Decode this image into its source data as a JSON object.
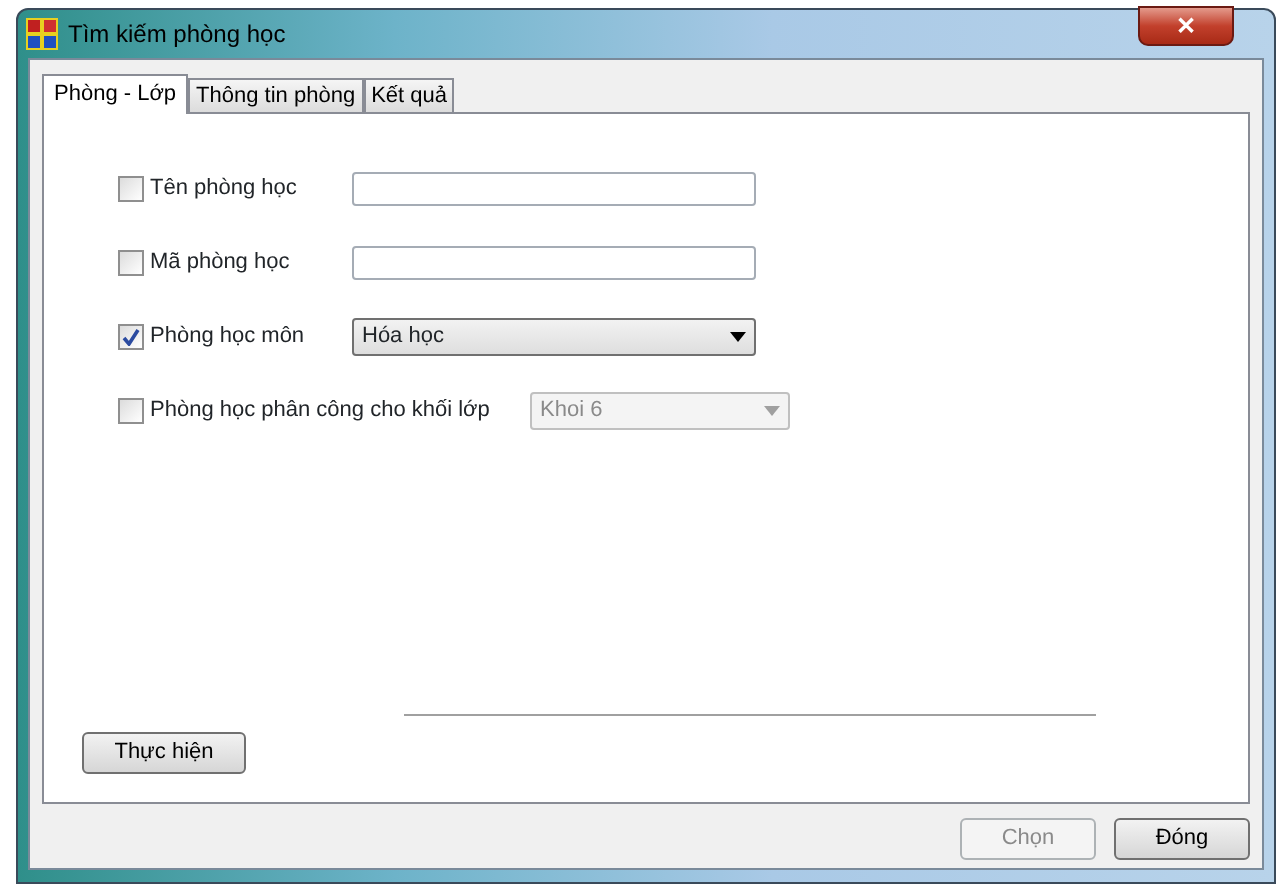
{
  "window": {
    "title": "Tìm kiếm phòng học",
    "close": "✕"
  },
  "tabs": [
    {
      "label": "Phòng - Lớp",
      "selected": true
    },
    {
      "label": "Thông tin phòng",
      "selected": false
    },
    {
      "label": "Kết quả",
      "selected": false
    }
  ],
  "criteria": [
    {
      "kind": "text",
      "label": "Tên phòng học",
      "checked": false
    },
    {
      "kind": "text",
      "label": "Mã phòng học",
      "checked": false
    },
    {
      "kind": "select",
      "label": "Phòng học môn",
      "checked": true,
      "value": "Hóa học",
      "disabled": false
    },
    {
      "kind": "select",
      "label": "Phòng học phân công cho khối lớp",
      "checked": false,
      "value": "Khoi 6",
      "disabled": true
    }
  ],
  "run_button": "Thực hiện",
  "buttons": [
    {
      "label": "Chọn",
      "disabled": true
    },
    {
      "label": "Đóng",
      "disabled": false
    }
  ]
}
